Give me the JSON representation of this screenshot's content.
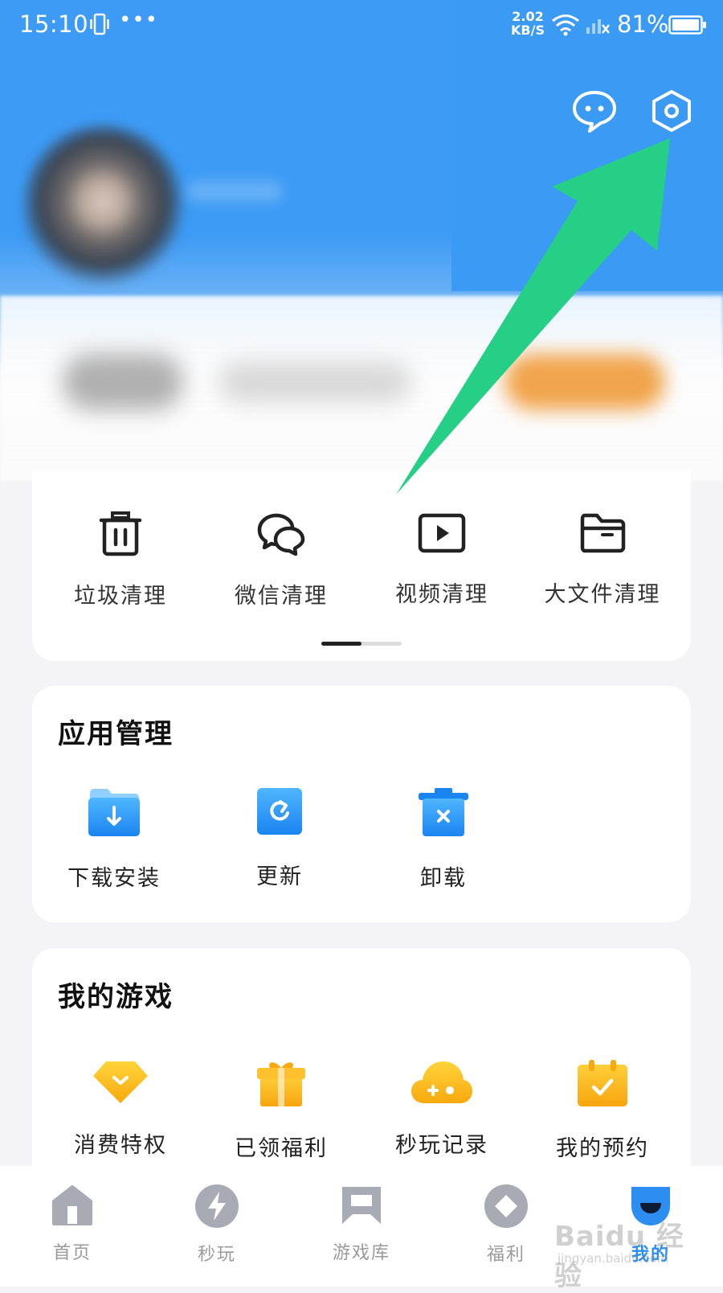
{
  "status_bar": {
    "time": "15:10",
    "dots": "•••",
    "speed_value": "2.02",
    "speed_unit": "KB/S",
    "battery": "81%"
  },
  "header": {
    "message_icon": "chat-bubble-icon",
    "settings_icon": "hexagon-settings-icon"
  },
  "clean_tools": [
    {
      "label": "垃圾清理",
      "icon": "trash-icon"
    },
    {
      "label": "微信清理",
      "icon": "wechat-icon"
    },
    {
      "label": "视频清理",
      "icon": "video-icon"
    },
    {
      "label": "大文件清理",
      "icon": "folder-icon"
    }
  ],
  "app_management": {
    "title": "应用管理",
    "items": [
      {
        "label": "下载安装",
        "icon": "download-folder-icon"
      },
      {
        "label": "更新",
        "icon": "refresh-icon"
      },
      {
        "label": "卸载",
        "icon": "uninstall-bin-icon"
      }
    ]
  },
  "my_games": {
    "title": "我的游戏",
    "items": [
      {
        "label": "消费特权",
        "icon": "diamond-icon"
      },
      {
        "label": "已领福利",
        "icon": "gift-icon"
      },
      {
        "label": "秒玩记录",
        "icon": "cloud-gamepad-icon"
      },
      {
        "label": "我的预约",
        "icon": "calendar-check-icon"
      }
    ]
  },
  "bottom_nav": [
    {
      "label": "首页",
      "icon": "home-icon"
    },
    {
      "label": "秒玩",
      "icon": "lightning-icon"
    },
    {
      "label": "游戏库",
      "icon": "game-library-icon"
    },
    {
      "label": "福利",
      "icon": "diamond-coin-icon"
    },
    {
      "label": "我的",
      "icon": "profile-face-icon",
      "active": true
    }
  ],
  "watermark": {
    "main": "Baidu 经验",
    "sub": "jingyan.baidu.com"
  },
  "colors": {
    "header_blue": "#3d9bf5",
    "accent_blue": "#2b8ef0",
    "game_yellow": "#fbbd12",
    "arrow_green": "#25cf86"
  }
}
